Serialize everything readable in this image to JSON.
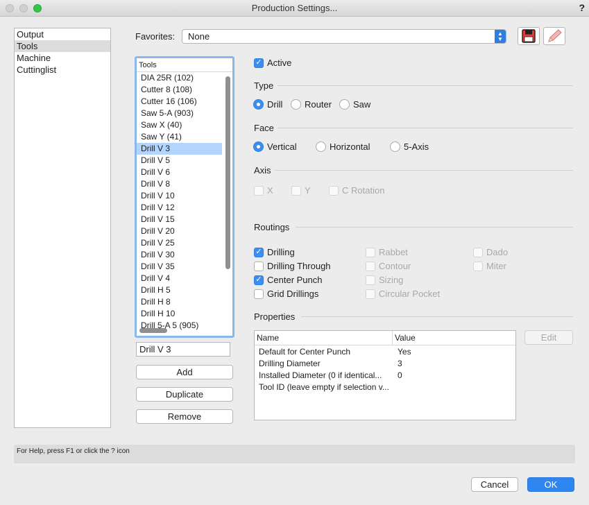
{
  "window": {
    "title": "Production Settings...",
    "help": "?"
  },
  "nav": {
    "items": [
      "Output",
      "Tools",
      "Machine",
      "Cuttinglist"
    ]
  },
  "favorites": {
    "label": "Favorites:",
    "value": "None"
  },
  "tools": {
    "header": "Tools",
    "items": [
      "DIA 25R (102)",
      "Cutter 8 (108)",
      "Cutter 16 (106)",
      "Saw 5-A (903)",
      "Saw X (40)",
      "Saw Y (41)",
      "Drill V 3",
      "Drill V 5",
      "Drill V 6",
      "Drill V 8",
      "Drill V 10",
      "Drill V 12",
      "Drill V 15",
      "Drill V 20",
      "Drill V 25",
      "Drill V 30",
      "Drill V 35",
      "Drill V 4",
      "Drill H 5",
      "Drill H 8",
      "Drill H 10",
      "Drill 5-A 5 (905)"
    ],
    "selected": "Drill V 3",
    "name_value": "Drill V 3",
    "add": "Add",
    "duplicate": "Duplicate",
    "remove": "Remove"
  },
  "active": {
    "label": "Active",
    "checked": true
  },
  "type": {
    "title": "Type",
    "options": [
      "Drill",
      "Router",
      "Saw"
    ],
    "selected": "Drill"
  },
  "face": {
    "title": "Face",
    "options": [
      "Vertical",
      "Horizontal",
      "5-Axis"
    ],
    "selected": "Vertical"
  },
  "axis": {
    "title": "Axis",
    "options": [
      "X",
      "Y",
      "C Rotation"
    ]
  },
  "routings": {
    "title": "Routings",
    "drilling": "Drilling",
    "drilling_through": "Drilling Through",
    "center_punch": "Center Punch",
    "grid_drillings": "Grid Drillings",
    "rabbet": "Rabbet",
    "contour": "Contour",
    "sizing": "Sizing",
    "circular_pocket": "Circular Pocket",
    "dado": "Dado",
    "miter": "Miter"
  },
  "properties": {
    "title": "Properties",
    "col_name": "Name",
    "col_value": "Value",
    "edit": "Edit",
    "rows": [
      {
        "name": "Default for Center Punch",
        "value": "Yes"
      },
      {
        "name": "Drilling Diameter",
        "value": "3"
      },
      {
        "name": "Installed Diameter (0 if identical...",
        "value": "0"
      },
      {
        "name": "Tool ID (leave empty if selection v...",
        "value": ""
      }
    ]
  },
  "help_text": "For Help, press F1 or click the ? icon",
  "buttons": {
    "cancel": "Cancel",
    "ok": "OK"
  },
  "colors": {
    "accent": "#3b8ef2",
    "selection": "#b3d4fc",
    "save_icon": "#e53935"
  }
}
